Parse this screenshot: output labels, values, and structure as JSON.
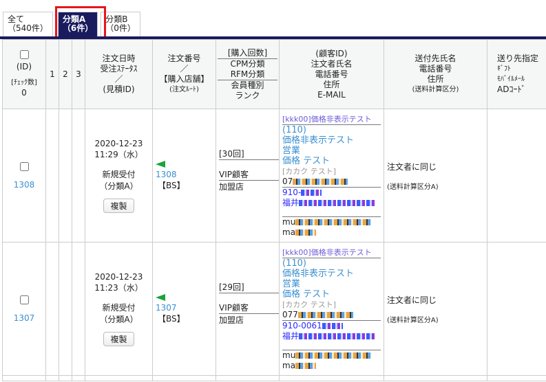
{
  "tabs": [
    {
      "line1": "全て",
      "line2": "（540件）"
    },
    {
      "line1": "分類A",
      "line2": "（6件）"
    },
    {
      "line1": "分類B",
      "line2": "（0件）"
    }
  ],
  "header": {
    "id": "(ID)",
    "check_count_label": "[ﾁｪｯｸ数]",
    "check_count": "0",
    "c1": "1",
    "c2": "2",
    "c3": "3",
    "date": [
      "注文日時",
      "受注ｽﾃｰﾀｽ",
      "／",
      "(見積ID)"
    ],
    "order": [
      "注文番号",
      "／",
      "【購入店舗】",
      "(注文ﾙｰﾄ)"
    ],
    "purchase": [
      "[購入回数]",
      "CPM分類",
      "RFM分類",
      "会員種別",
      "ランク"
    ],
    "customer": [
      "(顧客ID)",
      "注文者氏名",
      "電話番号",
      "住所",
      "E-MAIL"
    ],
    "ship": [
      "送付先氏名",
      "電話番号",
      "住所",
      "(送料計算区分)"
    ],
    "dest": [
      "送り先指定",
      "ｷﾞﾌﾄ",
      "ﾓﾊﾞｲﾙﾒｰﾙ",
      "ADｺｰﾄﾞ"
    ]
  },
  "rows": [
    {
      "id": "1308",
      "date": "2020-12-23",
      "time": "11:29（水）",
      "status": "新規受付",
      "category": "（分類A）",
      "copy": "複製",
      "order_no": "1308",
      "store": "【BS】",
      "count": "[30回]",
      "member": "VIP顧客",
      "rank": "加盟店",
      "cust_head": "[kkk00]価格非表示テスト",
      "cust_id": "(110)",
      "company": "価格非表示テスト",
      "dept": "営業",
      "name": "価格 テスト",
      "kana": "[カカク テスト]",
      "tel": "07",
      "zip": "910-",
      "addr": "福井",
      "mail1": "mu",
      "mail2": "ma",
      "ship_name": "注文者に同じ",
      "ship_calc": "(送料計算区分A)"
    },
    {
      "id": "1307",
      "date": "2020-12-23",
      "time": "11:23（水）",
      "status": "新規受付",
      "category": "（分類A）",
      "copy": "複製",
      "order_no": "1307",
      "store": "【BS】",
      "count": "[29回]",
      "member": "VIP顧客",
      "rank": "加盟店",
      "cust_head": "[kkk00]価格非表示テスト",
      "cust_id": "(110)",
      "company": "価格非表示テスト",
      "dept": "営業",
      "name": "価格 テスト",
      "kana": "[カカク テスト]",
      "tel": "077",
      "zip": "910-0061",
      "addr": "福井",
      "mail1": "mu",
      "mail2": "ma",
      "ship_name": "注文者に同じ",
      "ship_calc": "(送料計算区分A)"
    }
  ]
}
